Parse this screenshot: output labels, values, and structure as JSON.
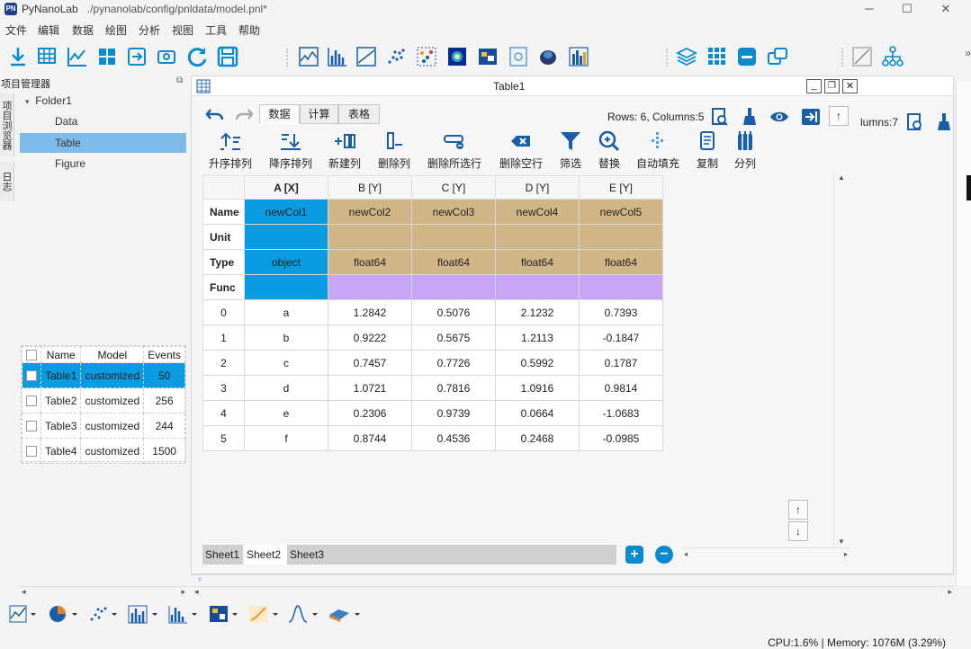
{
  "window": {
    "app_name": "PyNanoLab",
    "file_path": "./pynanolab/config/pnldata/model.pnl*",
    "logo": "PN"
  },
  "menu": [
    "文件",
    "编辑",
    "数据",
    "绘图",
    "分析",
    "视图",
    "工具",
    "帮助"
  ],
  "toolbar_icons": [
    "import-icon",
    "table-icon",
    "line-chart-icon",
    "grid-icon",
    "export-icon",
    "link-icon",
    "refresh-icon",
    "save-icon",
    "line-plot-icon",
    "bar-plot-icon",
    "area-plot-icon",
    "scatter-plot-icon",
    "scatter-color-icon",
    "heatmap-icon",
    "image-icon",
    "image-browse-icon",
    "3d-icon",
    "histogram-icon",
    "layers-icon",
    "apps-icon",
    "minus-icon",
    "window-icon",
    "draw-icon",
    "tree-icon"
  ],
  "left_panel": {
    "title": "项目管理器",
    "vtabs": [
      "项目浏览器",
      "日志"
    ],
    "tree": {
      "folder": "Folder1",
      "items": [
        "Data",
        "Table",
        "Figure"
      ],
      "selected": "Table"
    },
    "table": {
      "headers": [
        "Name",
        "Model",
        "Events"
      ],
      "rows": [
        {
          "name": "Table1",
          "model": "customized",
          "events": "50"
        },
        {
          "name": "Table2",
          "model": "customized",
          "events": "256"
        },
        {
          "name": "Table3",
          "model": "customized",
          "events": "244"
        },
        {
          "name": "Table4",
          "model": "customized",
          "events": "1500"
        }
      ]
    }
  },
  "table_window": {
    "title": "Table1",
    "tabs": [
      "数据",
      "计算",
      "表格"
    ],
    "rows_cols": "Rows: 6, Columns:5",
    "back_rows_cols": "lumns:7",
    "ribbon": [
      "升序排列",
      "降序排列",
      "新建列",
      "删除列",
      "删除所选行",
      "删除空行",
      "筛选",
      "替换",
      "自动填充",
      "复制",
      "分列"
    ],
    "row_headers": [
      "Name",
      "Unit",
      "Type",
      "Func"
    ],
    "columns": [
      {
        "header": "A [X]",
        "name": "newCol1",
        "unit": "",
        "type": "object",
        "func": ""
      },
      {
        "header": "B [Y]",
        "name": "newCol2",
        "unit": "",
        "type": "float64",
        "func": ""
      },
      {
        "header": "C [Y]",
        "name": "newCol3",
        "unit": "",
        "type": "float64",
        "func": ""
      },
      {
        "header": "D [Y]",
        "name": "newCol4",
        "unit": "",
        "type": "float64",
        "func": ""
      },
      {
        "header": "E [Y]",
        "name": "newCol5",
        "unit": "",
        "type": "float64",
        "func": ""
      }
    ],
    "data": [
      [
        "0",
        "a",
        "1.2842",
        "0.5076",
        "2.1232",
        "0.7393"
      ],
      [
        "1",
        "b",
        "0.9222",
        "0.5675",
        "1.2113",
        "-0.1847"
      ],
      [
        "2",
        "c",
        "0.7457",
        "0.7726",
        "0.5992",
        "0.1787"
      ],
      [
        "3",
        "d",
        "1.0721",
        "0.7816",
        "1.0916",
        "0.9814"
      ],
      [
        "4",
        "e",
        "0.2306",
        "0.9739",
        "0.0664",
        "-1.0683"
      ],
      [
        "5",
        "f",
        "0.8744",
        "0.4536",
        "0.2468",
        "-0.0985"
      ]
    ],
    "sheets": [
      "Sheet1",
      "Sheet2",
      "Sheet3"
    ],
    "active_sheet": "Sheet2"
  },
  "colors": {
    "accent": "#0a9be0",
    "tan": "#d2b587",
    "purple": "#c7a5f7",
    "selected_tree": "#7fbbe9"
  },
  "status": "CPU:1.6% | Memory: 1076M (3.29%)"
}
